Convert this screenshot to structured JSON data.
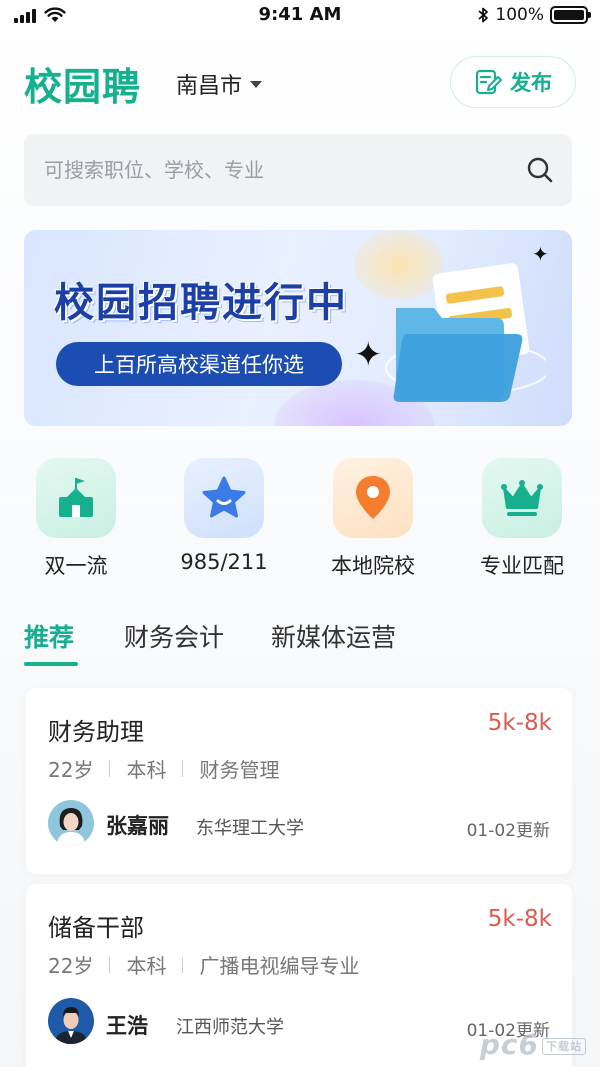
{
  "status_bar": {
    "time": "9:41 AM",
    "battery": "100%"
  },
  "header": {
    "logo": "校园聘",
    "city": "南昌市",
    "publish_label": "发布"
  },
  "search": {
    "placeholder": "可搜索职位、学校、专业"
  },
  "banner": {
    "title": "校园招聘进行中",
    "subtitle": "上百所高校渠道任你选"
  },
  "quick_entries": [
    {
      "label": "双一流",
      "icon": "school-flag-icon"
    },
    {
      "label": "985/211",
      "icon": "star-icon"
    },
    {
      "label": "本地院校",
      "icon": "location-pin-icon"
    },
    {
      "label": "专业匹配",
      "icon": "crown-icon"
    }
  ],
  "tabs": [
    {
      "label": "推荐",
      "active": true
    },
    {
      "label": "财务会计",
      "active": false
    },
    {
      "label": "新媒体运营",
      "active": false
    }
  ],
  "jobs": [
    {
      "title": "财务助理",
      "salary": "5k-8k",
      "age": "22岁",
      "degree": "本科",
      "major": "财务管理",
      "name": "张嘉丽",
      "school": "东华理工大学",
      "updated": "01-02更新"
    },
    {
      "title": "储备干部",
      "salary": "5k-8k",
      "age": "22岁",
      "degree": "本科",
      "major": "广播电视编导专业",
      "name": "王浩",
      "school": "江西师范大学",
      "updated": "01-02更新"
    }
  ],
  "watermark": {
    "text": "pc6",
    "sub": "下载站"
  },
  "colors": {
    "brand": "#17b08f",
    "salary": "#e05a4f",
    "banner_pill": "#1b4db3"
  }
}
